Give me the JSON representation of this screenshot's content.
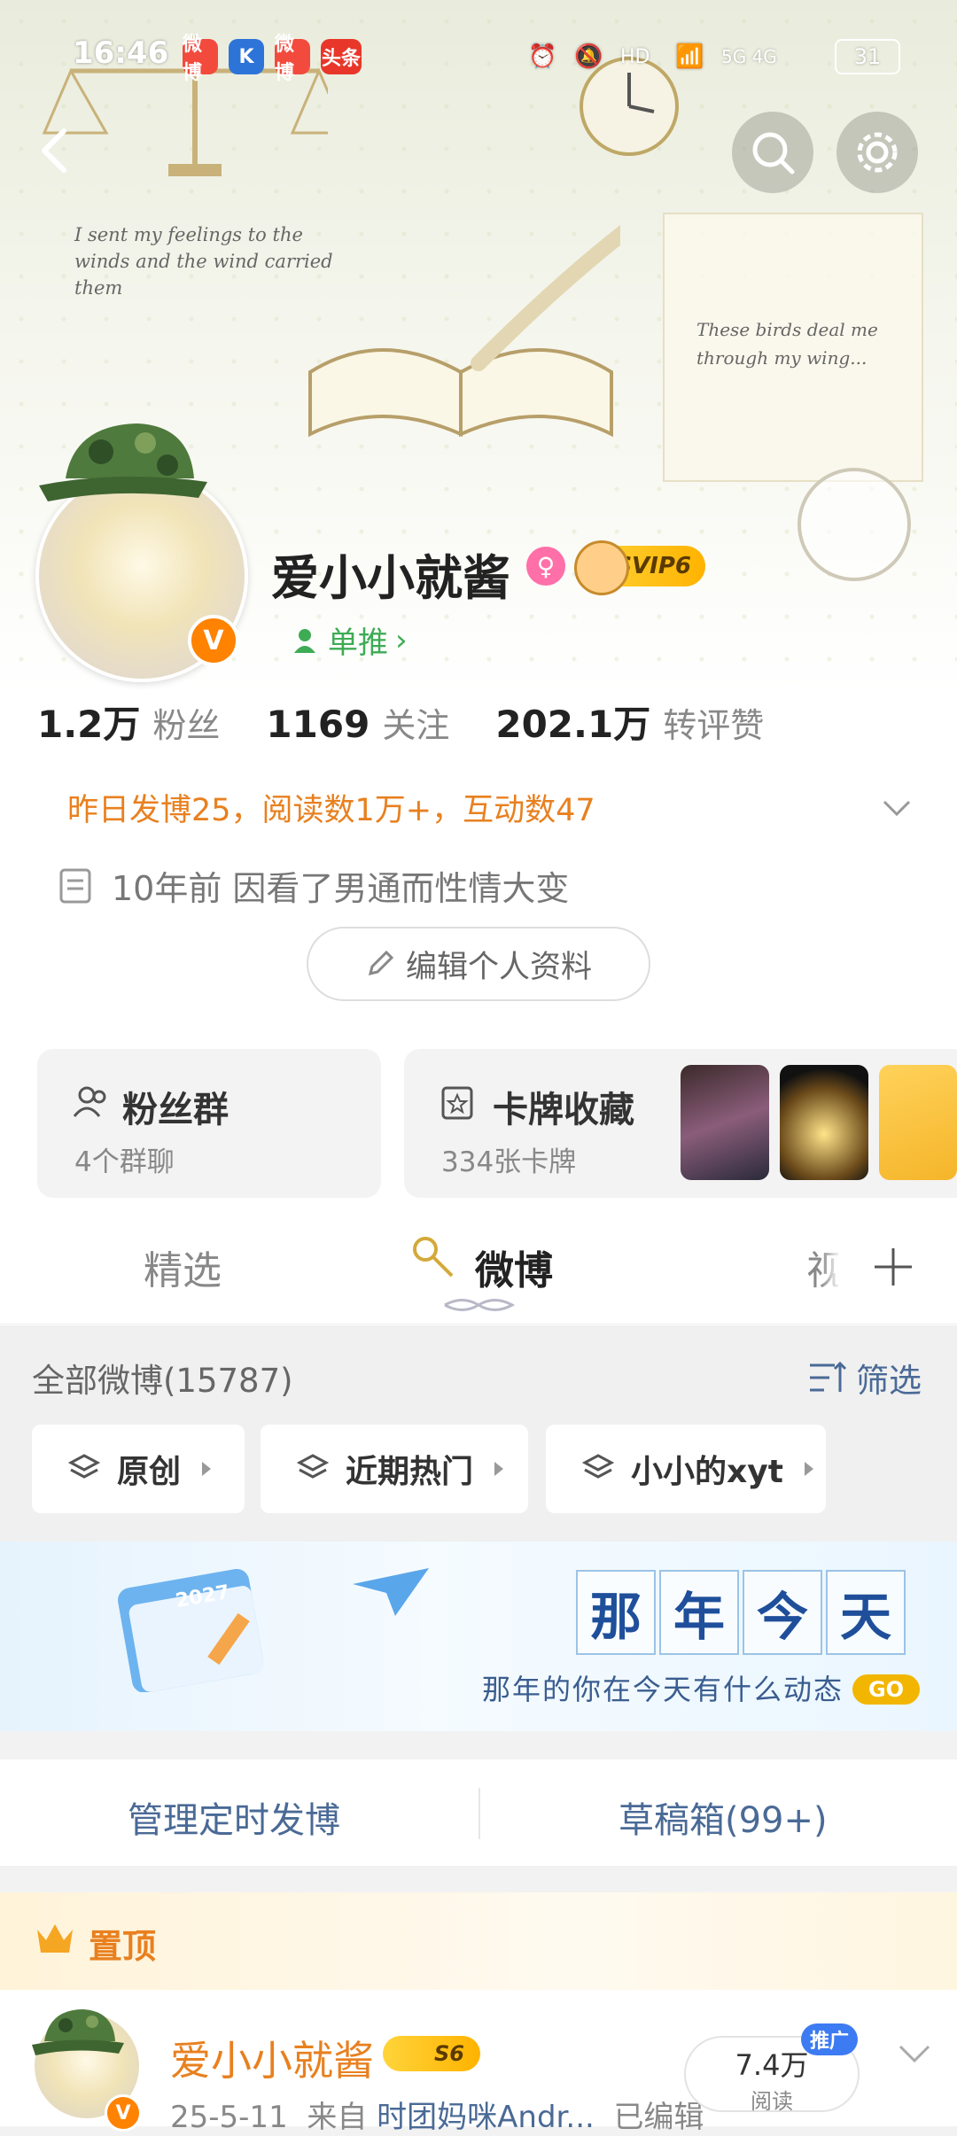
{
  "status_bar": {
    "time": "16:46",
    "network": "5G 4G",
    "battery": "31",
    "app_badges": [
      "微博",
      "K",
      "微博",
      "头条"
    ]
  },
  "header": {
    "art_caption_left": "I sent my feelings to the winds and the wind carried them",
    "art_caption_right": "These birds deal me through my wing..."
  },
  "profile": {
    "name": "爱小小就酱",
    "vip_label": "SVIP6",
    "danrui_label": "单推",
    "stats": [
      {
        "value": "1.2万",
        "label": "粉丝"
      },
      {
        "value": "1169",
        "label": "关注"
      },
      {
        "value": "202.1万",
        "label": "转评赞"
      }
    ],
    "yesterday": "昨日发博25，阅读数1万+，互动数47",
    "bio": "10年前 因看了男通而性情大变",
    "edit_button": "编辑个人资料"
  },
  "cards": {
    "fans_group": {
      "title": "粉丝群",
      "subtitle": "4个群聊"
    },
    "card_collection": {
      "title": "卡牌收藏",
      "subtitle": "334张卡牌"
    }
  },
  "tabs": {
    "items": [
      "精选",
      "微博",
      "视"
    ],
    "active": "微博"
  },
  "feed": {
    "all_count": "全部微博(15787)",
    "filter_label": "筛选",
    "chips": [
      "原创",
      "近期热门",
      "小小的xyt"
    ]
  },
  "banner": {
    "chars": [
      "那",
      "年",
      "今",
      "天"
    ],
    "subtitle": "那年的你在今天有什么动态",
    "go": "GO",
    "calendar_year": "2027"
  },
  "manage": {
    "scheduled": "管理定时发博",
    "drafts": "草稿箱(99+)"
  },
  "pinned_post": {
    "pin_label": "置顶",
    "author": "爱小小就酱",
    "level": "S6",
    "date": "25-5-11",
    "from_prefix": "来自",
    "source": "时团妈咪Andr...",
    "edited": "已编辑",
    "reads_value": "7.4万",
    "reads_label": "阅读",
    "promo": "推广"
  },
  "colors": {
    "accent_orange": "#e8801f",
    "link_blue": "#4a6a96",
    "verified_orange": "#ff8200",
    "green": "#3eab55"
  }
}
